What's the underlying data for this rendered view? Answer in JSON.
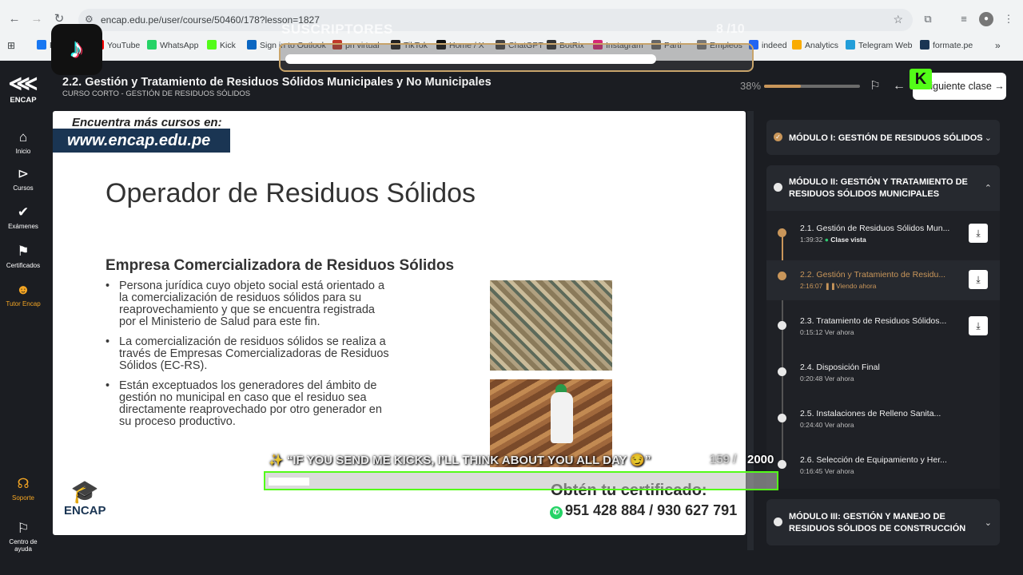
{
  "browser": {
    "url": "encap.edu.pe/user/course/50460/178?lesson=1827",
    "bookmarks": [
      {
        "label": "F",
        "color": "#1877f2"
      },
      {
        "label": "YouTube",
        "color": "#ff0000"
      },
      {
        "label": "WhatsApp",
        "color": "#25d366"
      },
      {
        "label": "Kick",
        "color": "#53fc18"
      },
      {
        "label": "Sign in to Outlook",
        "color": "#0a66c2"
      },
      {
        "label": "pn virtual",
        "color": "#c0392b"
      },
      {
        "label": "TikTok",
        "color": "#222222"
      },
      {
        "label": "Home / X",
        "color": "#111111"
      },
      {
        "label": "ChatGPT",
        "color": "#444444"
      },
      {
        "label": "BotRix",
        "color": "#333333"
      },
      {
        "label": "Instagram",
        "color": "#d62976"
      },
      {
        "label": "Parti",
        "color": "#666666"
      },
      {
        "label": "Empleos",
        "color": "#777777"
      },
      {
        "label": "indeed",
        "color": "#2164f3"
      },
      {
        "label": "Analytics",
        "color": "#f9ab00"
      },
      {
        "label": "Telegram Web",
        "color": "#229ed9"
      },
      {
        "label": "formate.pe",
        "color": "#1a3553"
      }
    ]
  },
  "overlay": {
    "subs_label": "SUSCRIPTORES",
    "subs_count": "8 /10",
    "subs_progress": 0.8,
    "kick_message": "✨ “IF YOU SEND ME KICKS, I’LL THINK ABOUT YOU ALL DAY 😏”",
    "kick_current": "159 /",
    "kick_goal": "2000",
    "kick_progress": 0.0795,
    "kick_badge": "K"
  },
  "header": {
    "course_title": "2.2. Gestión y Tratamiento de Residuos Sólidos Municipales y No Municipales",
    "course_subtitle": "CURSO CORTO - GESTIÓN DE RESIDUOS SÓLIDOS",
    "progress_label": "38%",
    "progress_value": 0.38,
    "next_label": "Siguiente clase →"
  },
  "sidebar": {
    "logo_text": "ENCAP",
    "items": [
      {
        "label": "Inicio",
        "icon": "home-icon"
      },
      {
        "label": "Cursos",
        "icon": "play-icon"
      },
      {
        "label": "Exámenes",
        "icon": "check-icon"
      },
      {
        "label": "Certificados",
        "icon": "bookmark-icon"
      },
      {
        "label": "Tutor Encap",
        "icon": "robot-icon"
      },
      {
        "label": "Soporte",
        "icon": "headset-icon"
      },
      {
        "label": "Centro de ayuda",
        "icon": "flag-icon"
      }
    ]
  },
  "slide": {
    "banner_top": "Encuentra más cursos en:",
    "banner_url": "www.encap.edu.pe",
    "title": "Operador de Residuos Sólidos",
    "heading": "Empresa Comercializadora de Residuos Sólidos",
    "bullets": [
      "Persona jurídica cuyo objeto social está orientado a la comercialización de residuos sólidos para su reaprovechamiento y que se encuentra registrada por el Ministerio de Salud para este fin.",
      "La comercialización de residuos sólidos se realiza a través de Empresas Comercializadoras de Residuos Sólidos (EC-RS).",
      "Están exceptuados los generadores del ámbito de gestión no municipal en caso que el residuo sea directamente reaprovechado por otro generador en su proceso productivo."
    ],
    "logo_text": "ENCAP",
    "cert_title": "Obtén tu certificado:",
    "cert_phone": "951 428 884 / 930 627 791"
  },
  "modules": [
    {
      "title": "MÓDULO I: GESTIÓN DE RESIDUOS SÓLIDOS",
      "expanded": false,
      "done": true
    },
    {
      "title": "MÓDULO II: GESTIÓN Y TRATAMIENTO DE RESIDUOS SÓLIDOS MUNICIPALES",
      "expanded": true,
      "done": false
    },
    {
      "title": "MÓDULO III: GESTIÓN Y MANEJO DE RESIDUOS SÓLIDOS DE CONSTRUCCIÓN",
      "expanded": false,
      "done": false
    }
  ],
  "lessons": [
    {
      "title": "2.1. Gestión de Residuos Sólidos Mun...",
      "duration": "1:39:32",
      "status": "Clase vista",
      "download": true,
      "state": "done"
    },
    {
      "title": "2.2. Gestión y Tratamiento de Residu...",
      "duration": "2:16:07",
      "status": "Viendo ahora",
      "download": true,
      "state": "active"
    },
    {
      "title": "2.3. Tratamiento de Residuos Sólidos...",
      "duration": "0:15:12",
      "status": "Ver ahora",
      "download": true,
      "state": "pending"
    },
    {
      "title": "2.4. Disposición Final",
      "duration": "0:20:48",
      "status": "Ver ahora",
      "download": false,
      "state": "pending"
    },
    {
      "title": "2.5. Instalaciones de Relleno Sanita...",
      "duration": "0:24:40",
      "status": "Ver ahora",
      "download": false,
      "state": "pending"
    },
    {
      "title": "2.6. Selección de Equipamiento y Her...",
      "duration": "0:16:45",
      "status": "Ver ahora",
      "download": false,
      "state": "pending"
    }
  ],
  "colors": {
    "accent": "#c9965a",
    "kick": "#53fc18",
    "dark": "#1b1d22",
    "panel": "#26292f"
  }
}
